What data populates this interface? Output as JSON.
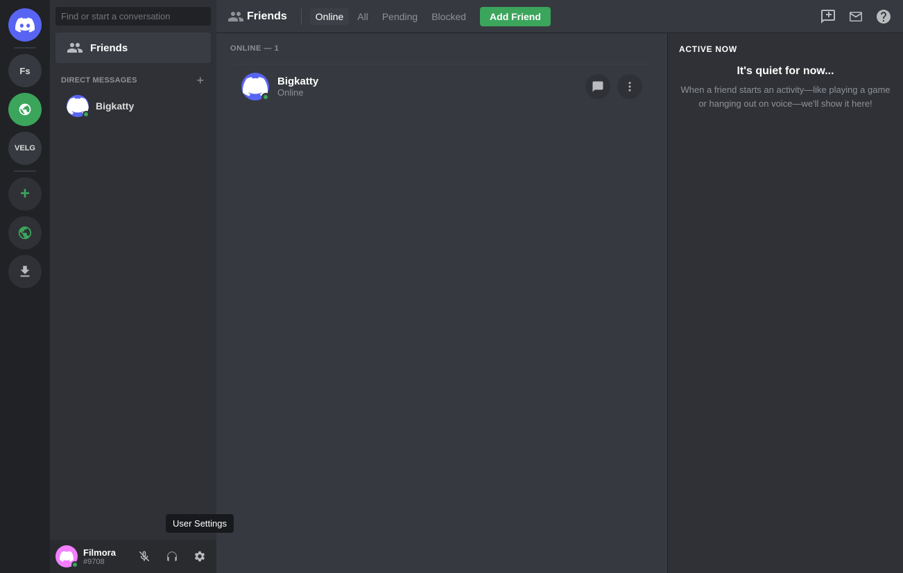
{
  "serverSidebar": {
    "servers": [
      {
        "id": "home",
        "type": "discord-home",
        "label": "Discord Home"
      },
      {
        "id": "fs",
        "type": "text",
        "text": "Fs",
        "label": "Fs Server"
      },
      {
        "id": "explore",
        "type": "green",
        "label": "Explore"
      },
      {
        "id": "velg",
        "type": "text",
        "text": "VELG",
        "label": "VELG Server"
      },
      {
        "id": "add",
        "type": "dark",
        "text": "+",
        "label": "Add Server"
      },
      {
        "id": "discover",
        "type": "dark",
        "text": "🧭",
        "label": "Discover"
      },
      {
        "id": "download",
        "type": "dark",
        "text": "⬇",
        "label": "Download Apps"
      }
    ]
  },
  "dmSidebar": {
    "searchPlaceholder": "Find or start a conversation",
    "friendsLabel": "Friends",
    "directMessagesLabel": "Direct Messages",
    "addDMTooltip": "New DM",
    "dmUsers": [
      {
        "id": "bigkatty",
        "name": "Bigkatty",
        "status": "online"
      }
    ]
  },
  "userPanel": {
    "username": "Filmora",
    "tag": "#9708",
    "controls": [
      {
        "id": "mute",
        "icon": "🎤",
        "label": "Mute"
      },
      {
        "id": "deafen",
        "icon": "🎧",
        "label": "Deafen"
      },
      {
        "id": "settings",
        "icon": "⚙",
        "label": "User Settings"
      }
    ],
    "settingsTooltip": "User Settings"
  },
  "topNav": {
    "friendsIcon": "👥",
    "title": "Friends",
    "tabs": [
      {
        "id": "online",
        "label": "Online",
        "active": true
      },
      {
        "id": "all",
        "label": "All",
        "active": false
      },
      {
        "id": "pending",
        "label": "Pending",
        "active": false
      },
      {
        "id": "blocked",
        "label": "Blocked",
        "active": false
      }
    ],
    "addFriendLabel": "Add Friend",
    "actions": [
      {
        "id": "new-group-dm",
        "icon": "💬",
        "label": "New Group DM"
      },
      {
        "id": "inbox",
        "icon": "📥",
        "label": "Inbox"
      },
      {
        "id": "help",
        "icon": "❓",
        "label": "Help"
      }
    ]
  },
  "friendsList": {
    "onlineHeader": "Online — 1",
    "friends": [
      {
        "id": "bigkatty",
        "name": "Bigkatty",
        "status": "Online",
        "actions": [
          {
            "id": "message",
            "icon": "💬",
            "label": "Message"
          },
          {
            "id": "more",
            "icon": "⋮",
            "label": "More"
          }
        ]
      }
    ]
  },
  "activeNow": {
    "title": "ACTIVE NOW",
    "quietTitle": "It's quiet for now...",
    "quietDesc": "When a friend starts an activity—like playing a game or hanging out on voice—we'll show it here!"
  }
}
